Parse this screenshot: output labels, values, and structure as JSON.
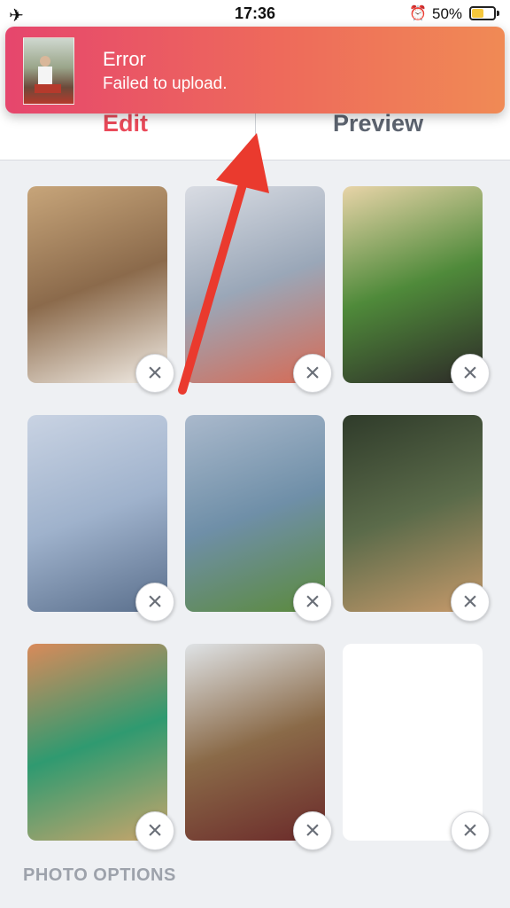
{
  "status_bar": {
    "airplane_icon": "✈",
    "time": "17:36",
    "alarm_icon": "⏰",
    "battery_percent": "50%",
    "battery_level": 0.5
  },
  "notification": {
    "title": "Error",
    "message": "Failed to upload."
  },
  "tabs": [
    {
      "label": "Edit",
      "active": true
    },
    {
      "label": "Preview",
      "active": false
    }
  ],
  "photos": [
    {
      "description": "man in white shirt portrait",
      "colors": [
        "#c7a57a",
        "#8b6a4b",
        "#f2ede6"
      ],
      "remove_label": "×"
    },
    {
      "description": "man on kayak at sea",
      "colors": [
        "#d9dce3",
        "#9aa7b8",
        "#d76a54"
      ],
      "remove_label": "×"
    },
    {
      "description": "man kneeling on lawn with palms",
      "colors": [
        "#e8d4a8",
        "#4f8a3a",
        "#2d2a28"
      ],
      "remove_label": "×"
    },
    {
      "description": "tandem skydivers",
      "colors": [
        "#c9d3e3",
        "#9fb2cc",
        "#5a6f8c"
      ],
      "remove_label": "×"
    },
    {
      "description": "two men in suits on lawn",
      "colors": [
        "#aab9cc",
        "#6f8fa8",
        "#5b8a3c"
      ],
      "remove_label": "×"
    },
    {
      "description": "man with cat on chair",
      "colors": [
        "#2f3b2a",
        "#5b6b4a",
        "#c79a6b"
      ],
      "remove_label": "×"
    },
    {
      "description": "man speaking in green room",
      "colors": [
        "#d98a5a",
        "#2f9a70",
        "#c9a56b"
      ],
      "remove_label": "×"
    },
    {
      "description": "man at party by pool",
      "colors": [
        "#dfe3e6",
        "#8a6a48",
        "#6b2a2a"
      ],
      "remove_label": "×"
    },
    {
      "description": "empty slot",
      "colors": [],
      "remove_label": "×"
    }
  ],
  "photo_options_title": "PHOTO OPTIONS",
  "colors": {
    "accent": "#ea4a5a",
    "notification_start": "#e6466d",
    "notification_end": "#f08a55",
    "background": "#eef0f3",
    "arrow": "#ea3a2e"
  }
}
